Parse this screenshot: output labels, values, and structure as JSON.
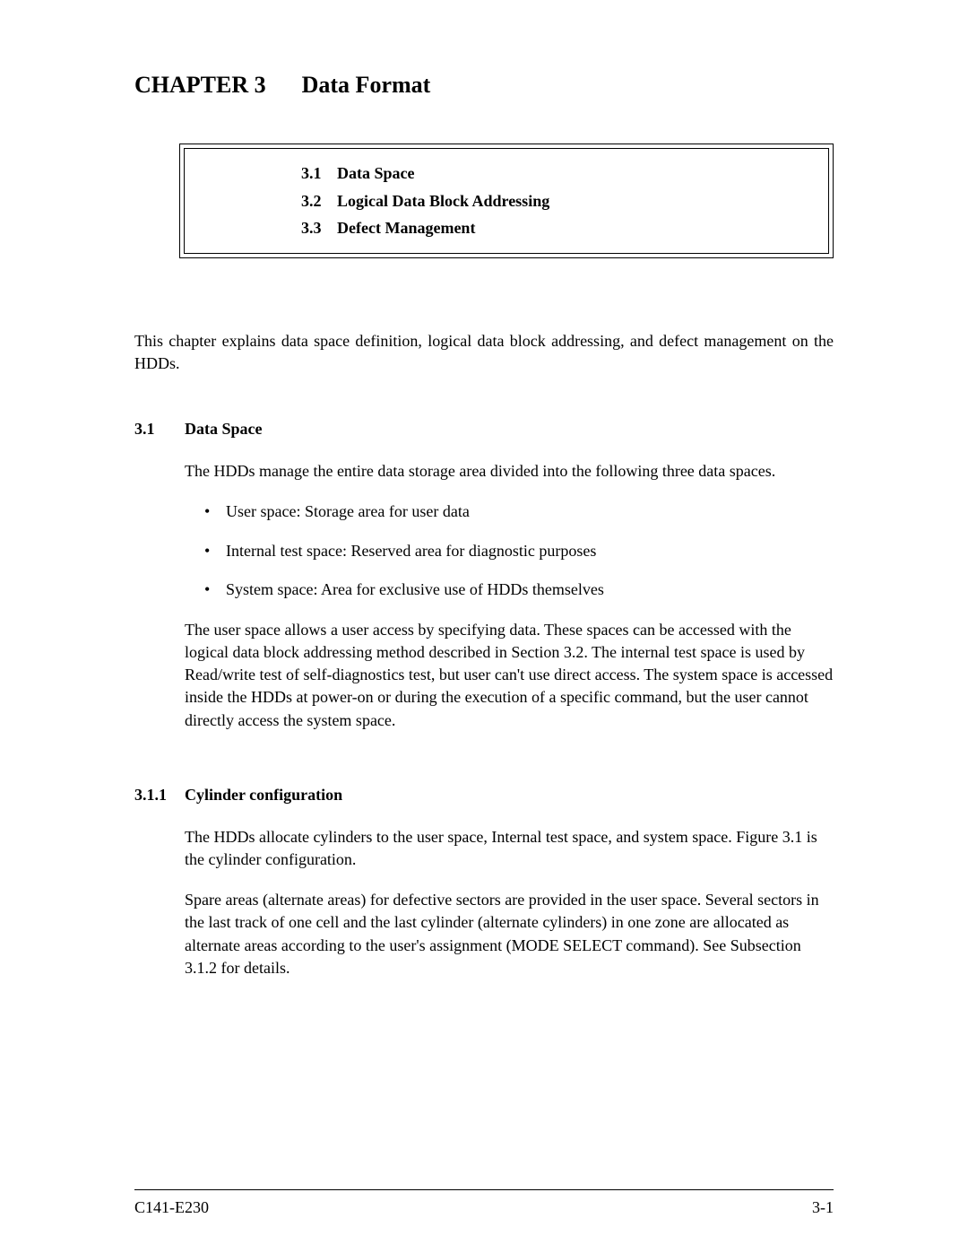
{
  "chapter": {
    "label": "CHAPTER 3",
    "title": "Data Format"
  },
  "toc": [
    {
      "num": "3.1",
      "title": "Data Space"
    },
    {
      "num": "3.2",
      "title": "Logical Data Block Addressing"
    },
    {
      "num": "3.3",
      "title": "Defect Management"
    }
  ],
  "intro": "This chapter explains data space definition, logical data block addressing, and defect management on the HDDs.",
  "section_3_1": {
    "num": "3.1",
    "title": "Data Space",
    "p1": "The HDDs manage the entire data storage area divided into the following three data spaces.",
    "bullets": [
      "User space: Storage area for user data",
      "Internal test space: Reserved area for diagnostic purposes",
      "System space: Area for exclusive use of HDDs themselves"
    ],
    "p2": "The user space allows a user access by specifying data.  These spaces can be accessed with the logical data block addressing method described in Section 3.2.  The internal test space is used by Read/write test of self-diagnostics test, but user can't use direct access.  The system space is accessed inside the HDDs at power-on or during the execution of a specific command, but the user cannot directly access the system space."
  },
  "section_3_1_1": {
    "num": "3.1.1",
    "title": "Cylinder configuration",
    "p1": "The HDDs allocate cylinders to the user space, Internal test space, and system space.  Figure 3.1 is the cylinder configuration.",
    "p2": "Spare areas (alternate areas) for defective sectors are provided in the user space.  Several sectors in the last track of one cell and the last cylinder (alternate cylinders) in one zone are allocated as alternate areas according to the user's assignment (MODE SELECT command).  See Subsection 3.1.2 for details."
  },
  "footer": {
    "left": "C141-E230",
    "right": "3-1"
  }
}
